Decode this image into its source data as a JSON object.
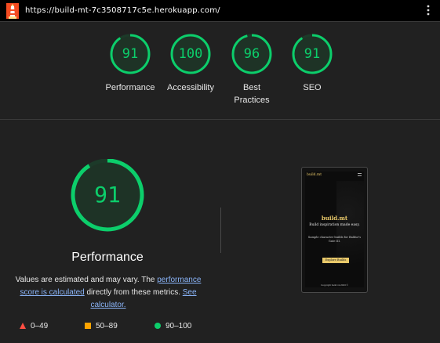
{
  "topbar": {
    "url": "https://build-mt-7c3508717c5e.herokuapp.com/",
    "logo_icon": "lighthouse-icon",
    "menu_icon": "more-vertical-icon"
  },
  "categories": [
    {
      "score": "91",
      "label": "Performance"
    },
    {
      "score": "100",
      "label": "Accessibility"
    },
    {
      "score": "96",
      "label": "Best Practices"
    },
    {
      "score": "91",
      "label": "SEO"
    }
  ],
  "main": {
    "score": "91",
    "score_fraction": 0.91,
    "title": "Performance",
    "note_text1": "Values are estimated and may vary. The ",
    "note_link1": "performance score is calculated",
    "note_text2": " directly from these metrics. ",
    "note_link2": "See calculator."
  },
  "legend": [
    {
      "icon": "triangle-fail-icon",
      "range": "0–49",
      "color": "#ff4e42"
    },
    {
      "icon": "square-average-icon",
      "range": "50–89",
      "color": "#ffa400"
    },
    {
      "icon": "circle-pass-icon",
      "range": "90–100",
      "color": "#0cce6b"
    }
  ],
  "screenshot": {
    "header": "build.mt",
    "brand": "build.mt",
    "tagline": "Build inspiration made easy.",
    "subtitle": "Sample character builds for Baldur's Gate III.",
    "cta": "Explore Builds",
    "footer": "Copyright build.mt 2023 ©"
  },
  "colors": {
    "pass": "#0cce6b",
    "background": "#212121"
  }
}
